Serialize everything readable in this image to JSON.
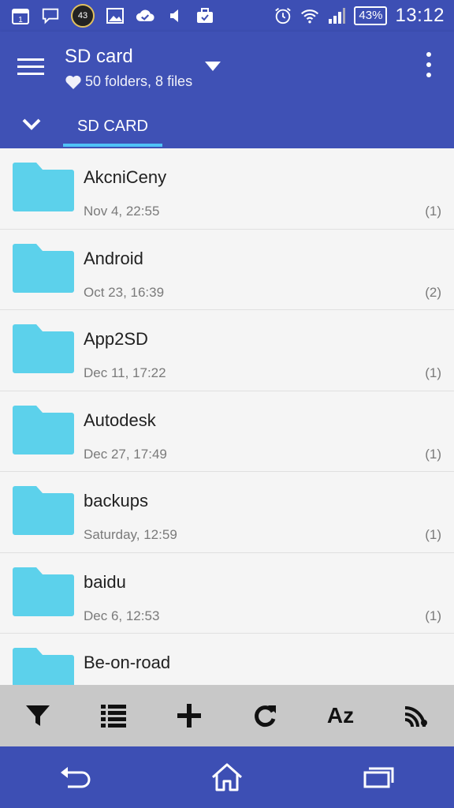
{
  "status_bar": {
    "calendar_day": "1",
    "badge_number": "43",
    "battery": "43%",
    "time": "13:12"
  },
  "app_bar": {
    "title": "SD card",
    "subtitle": "50 folders, 8 files",
    "tab_label": "SD CARD"
  },
  "files": [
    {
      "name": "AkcniCeny",
      "date": "Nov 4, 22:55",
      "count": "(1)"
    },
    {
      "name": "Android",
      "date": "Oct 23, 16:39",
      "count": "(2)"
    },
    {
      "name": "App2SD",
      "date": "Dec 11, 17:22",
      "count": "(1)"
    },
    {
      "name": "Autodesk",
      "date": "Dec 27, 17:49",
      "count": "(1)"
    },
    {
      "name": "backups",
      "date": "Saturday, 12:59",
      "count": "(1)"
    },
    {
      "name": "baidu",
      "date": "Dec 6, 12:53",
      "count": "(1)"
    },
    {
      "name": "Be-on-road",
      "date": "",
      "count": ""
    }
  ],
  "toolbar": {
    "sort_label": "Az"
  },
  "colors": {
    "primary": "#3f51b5",
    "accent": "#4fc3f7",
    "folder": "#5cd1eb",
    "toolbar_bg": "#c8c8c8"
  },
  "icons": {
    "toolbar": [
      "filter-icon",
      "list-view-icon",
      "add-icon",
      "refresh-icon",
      "sort-az-icon",
      "cast-icon"
    ],
    "nav": [
      "back-icon",
      "home-icon",
      "recents-icon"
    ]
  }
}
